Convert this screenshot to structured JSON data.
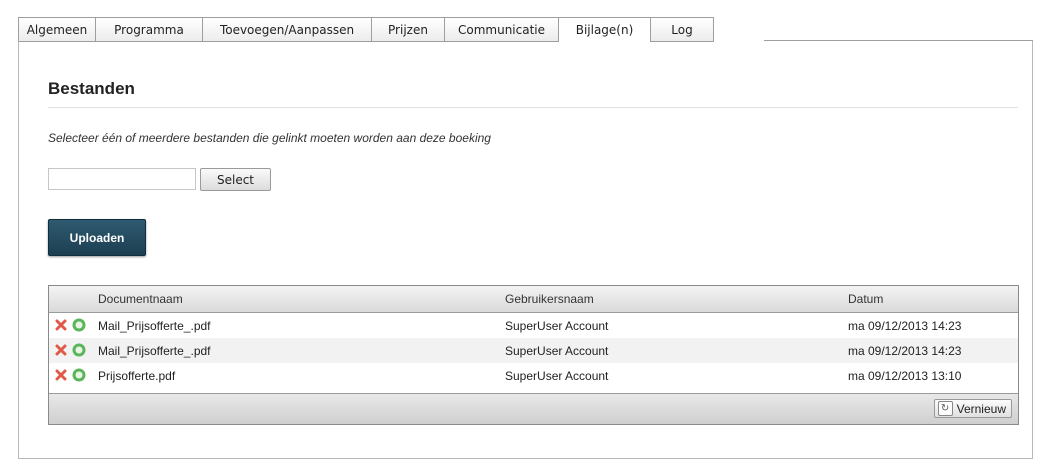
{
  "tabs": [
    {
      "label": "Algemeen",
      "active": false
    },
    {
      "label": "Programma",
      "active": false
    },
    {
      "label": "Toevoegen/Aanpassen",
      "active": false
    },
    {
      "label": "Prijzen",
      "active": false
    },
    {
      "label": "Communicatie",
      "active": false
    },
    {
      "label": "Bijlage(n)",
      "active": true
    },
    {
      "label": "Log",
      "active": false
    }
  ],
  "section": {
    "title": "Bestanden",
    "hint": "Selecteer één of meerdere bestanden die gelinkt moeten worden aan deze boeking"
  },
  "file_input": {
    "value": "",
    "select_label": "Select"
  },
  "upload_label": "Uploaden",
  "grid": {
    "columns": [
      "Documentnaam",
      "Gebruikersnaam",
      "Datum"
    ],
    "rows": [
      {
        "name": "Mail_Prijsofferte_.pdf",
        "user": "SuperUser Account",
        "date": "ma 09/12/2013 14:23"
      },
      {
        "name": "Mail_Prijsofferte_.pdf",
        "user": "SuperUser Account",
        "date": "ma 09/12/2013 14:23"
      },
      {
        "name": "Prijsofferte.pdf",
        "user": "SuperUser Account",
        "date": "ma 09/12/2013 13:10"
      }
    ],
    "refresh_label": "Vernieuw"
  },
  "icons": {
    "delete": "delete-x-icon",
    "approve": "approve-circle-icon",
    "refresh": "refresh-icon"
  },
  "colors": {
    "accent": "#1f4356",
    "delete": "#e05a4a",
    "approve": "#5bb55b"
  }
}
